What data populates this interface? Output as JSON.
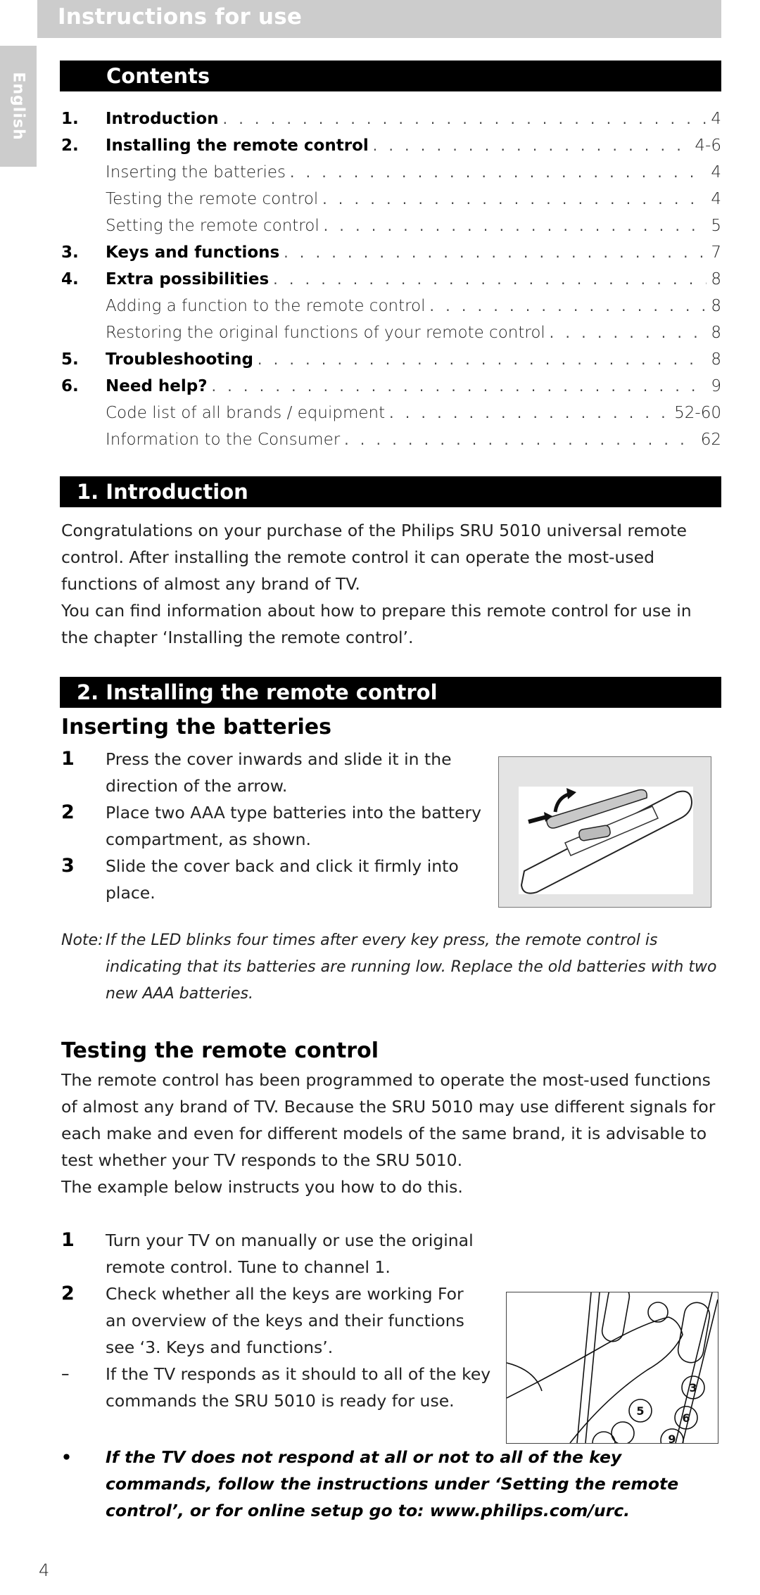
{
  "header": {
    "title": "Instructions for use"
  },
  "language_tab": {
    "label": "English"
  },
  "contents": {
    "title": "Contents",
    "entries": [
      {
        "num": "1.",
        "title": "Introduction",
        "page": "4",
        "major": true
      },
      {
        "num": "2.",
        "title": "Installing the remote control",
        "page": "4-6",
        "major": true
      },
      {
        "num": "",
        "title": "Inserting the batteries",
        "page": "4",
        "major": false
      },
      {
        "num": "",
        "title": "Testing the remote control",
        "page": "4",
        "major": false
      },
      {
        "num": "",
        "title": "Setting the remote control",
        "page": "5",
        "major": false
      },
      {
        "num": "3.",
        "title": "Keys and functions",
        "page": "7",
        "major": true
      },
      {
        "num": "4.",
        "title": "Extra possibilities",
        "page": "8",
        "major": true
      },
      {
        "num": "",
        "title": "Adding a function to the remote control",
        "page": "8",
        "major": false
      },
      {
        "num": "",
        "title": "Restoring the original functions of your remote control",
        "page": "8",
        "major": false
      },
      {
        "num": "5.",
        "title": "Troubleshooting",
        "page": "8",
        "major": true
      },
      {
        "num": "6.",
        "title": "Need help?",
        "page": "9",
        "major": true
      },
      {
        "num": "",
        "title": "Code list of all brands / equipment",
        "page": "52-60",
        "major": false
      },
      {
        "num": "",
        "title": "Information to the Consumer",
        "page": "62",
        "major": false
      }
    ]
  },
  "introduction": {
    "title": "1. Introduction",
    "paragraphs": [
      "Congratulations on your purchase of the Philips SRU 5010 universal remote control. After installing the remote control it can operate the most-used functions of almost any brand of TV.",
      "You can find information about how to prepare this remote control for use in the chapter ‘Installing the remote control’."
    ]
  },
  "installing": {
    "title": "2. Installing the remote control",
    "batteries": {
      "heading": "Inserting the batteries",
      "steps": [
        {
          "n": "1",
          "text": "Press the cover inwards and slide it in the direction of the arrow."
        },
        {
          "n": "2",
          "text": "Place two AAA type batteries into the battery compartment, as shown."
        },
        {
          "n": "3",
          "text": "Slide the cover back and click it firmly into place."
        }
      ],
      "figure": "battery-compartment-illustration"
    },
    "note": {
      "label": "Note:",
      "text": "If the LED blinks four times after every key press, the remote control is indicating that its batteries are running low. Replace the old batteries with two new AAA batteries."
    },
    "testing": {
      "heading": "Testing the remote control",
      "paragraphs": [
        "The remote control has been programmed to operate the most-used functions of almost any brand of TV. Because the SRU 5010 may use different signals for each make and even for different models of the same brand, it is advisable to test whether your TV responds to the SRU 5010.",
        "The example below instructs you how to do this."
      ],
      "steps": [
        {
          "n": "1",
          "text": "Turn your TV on manually or use the original remote control. Tune to channel 1."
        },
        {
          "n": "2",
          "text": "Check whether all the keys are working For an overview of the keys and their functions see ‘3. Keys and functions’."
        },
        {
          "n": "–",
          "text": "If the TV responds as it should to all of the key commands the SRU 5010 is ready for use."
        }
      ],
      "figure": "finger-pressing-remote-keys-illustration",
      "bullet": {
        "mark": "•",
        "text": "If the TV does not respond at all or not to all of the key commands, follow the instructions under ‘Setting the remote control’, or for online setup go to: www.philips.com/urc."
      }
    }
  },
  "footer": {
    "page_number": "4"
  }
}
